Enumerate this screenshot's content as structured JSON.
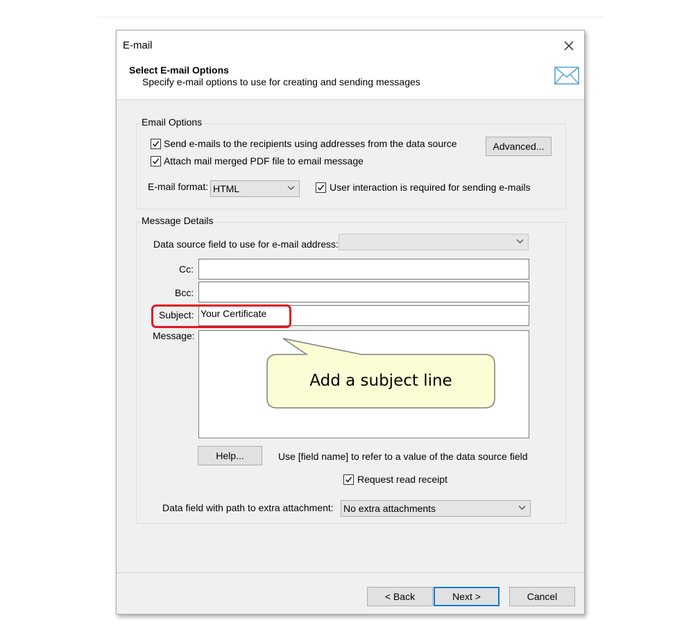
{
  "window": {
    "title": "E-mail",
    "header_title": "Select E-mail Options",
    "header_subtitle": "Specify e-mail options to use for creating and sending messages"
  },
  "email_options": {
    "group_title": "Email Options",
    "send_to_recipients": {
      "label": "Send e-mails to the recipients using addresses from the data source",
      "checked": true
    },
    "attach_pdf": {
      "label": "Attach mail merged PDF file to email message",
      "checked": true
    },
    "advanced_button": "Advanced...",
    "format_label": "E-mail format:",
    "format_value": "HTML",
    "user_interaction": {
      "label": "User interaction is required for sending e-mails",
      "checked": true
    }
  },
  "message_details": {
    "group_title": "Message Details",
    "address_field_label": "Data source field to use for e-mail address:",
    "address_field_value": "",
    "cc_label": "Cc:",
    "cc_value": "",
    "bcc_label": "Bcc:",
    "bcc_value": "",
    "subject_label": "Subject:",
    "subject_value": "Your Certificate",
    "message_label": "Message:",
    "message_value": "",
    "help_button": "Help...",
    "help_hint": "Use [field name] to refer to a value of the data source field",
    "read_receipt": {
      "label": "Request read receipt",
      "checked": true
    },
    "attachment_label": "Data field with path to extra attachment:",
    "attachment_value": "No extra attachments"
  },
  "callout": {
    "text": "Add a subject line"
  },
  "footer": {
    "back": "< Back",
    "next": "Next >",
    "cancel": "Cancel"
  },
  "colors": {
    "highlight": "#e8141f",
    "callout_fill": "#fdfdd5",
    "default_button_border": "#0078d7"
  }
}
